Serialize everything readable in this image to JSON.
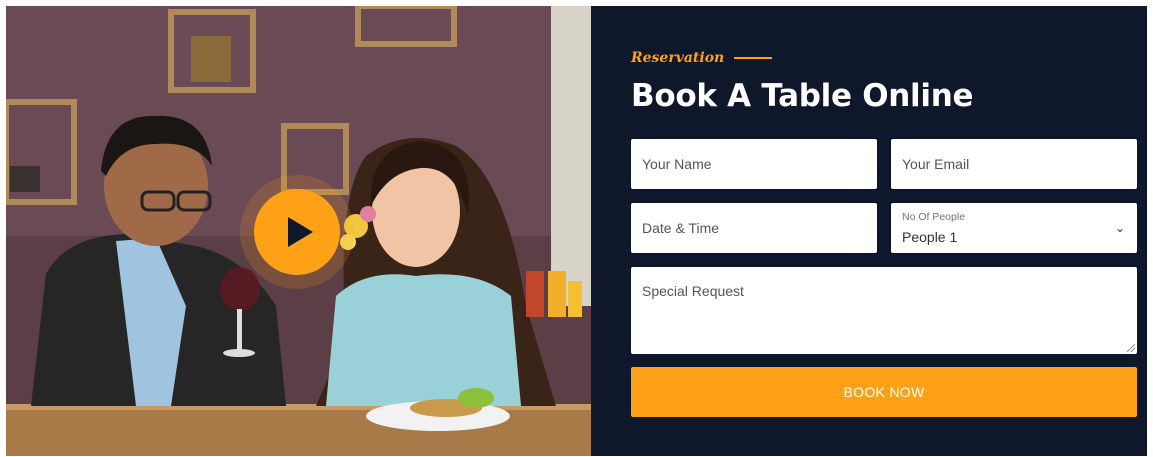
{
  "video": {
    "play_icon": "play-icon"
  },
  "reservation": {
    "eyebrow": "Reservation",
    "title": "Book A Table Online",
    "fields": {
      "name_placeholder": "Your Name",
      "email_placeholder": "Your Email",
      "datetime_placeholder": "Date & Time",
      "people_label": "No Of People",
      "people_value": "People 1",
      "request_placeholder": "Special Request"
    },
    "submit_label": "BOOK NOW"
  },
  "colors": {
    "accent": "#fea116",
    "panel": "#0f172b",
    "field_bg": "#ffffff"
  }
}
